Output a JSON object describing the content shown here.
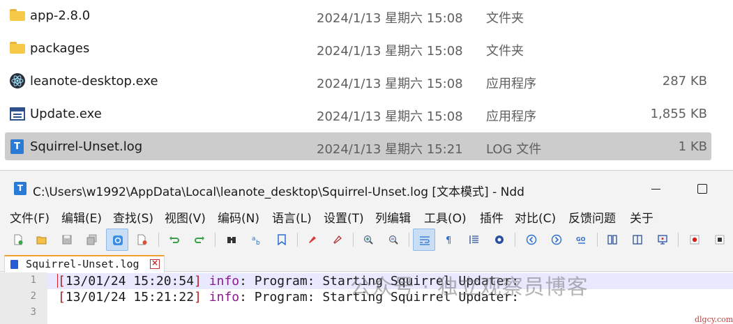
{
  "explorer": {
    "files": [
      {
        "name": "app-2.8.0",
        "date": "2024/1/13 星期六 15:08",
        "type": "文件夹",
        "size": "",
        "icon": "folder-icon",
        "selected": false
      },
      {
        "name": "packages",
        "date": "2024/1/13 星期六 15:08",
        "type": "文件夹",
        "size": "",
        "icon": "folder-icon",
        "selected": false
      },
      {
        "name": "leanote-desktop.exe",
        "date": "2024/1/13 星期六 15:08",
        "type": "应用程序",
        "size": "287 KB",
        "icon": "electron-app-icon",
        "selected": false
      },
      {
        "name": "Update.exe",
        "date": "2024/1/13 星期六 15:08",
        "type": "应用程序",
        "size": "1,855 KB",
        "icon": "exe-window-icon",
        "selected": false
      },
      {
        "name": "Squirrel-Unset.log",
        "date": "2024/1/13 星期六 15:21",
        "type": "LOG 文件",
        "size": "1 KB",
        "icon": "log-file-icon",
        "selected": true
      }
    ],
    "colors": {
      "selected_row": "#cccccc",
      "folder": "#f7c948"
    }
  },
  "window": {
    "title": "C:\\Users\\w1992\\AppData\\Local\\leanote_desktop\\Squirrel-Unset.log [文本模式] - Ndd",
    "menu": [
      "文件(F)",
      "编辑(E)",
      "查找(S)",
      "视图(V)",
      "编码(N)",
      "语言(L)",
      "设置(T)",
      "列编辑",
      "工具(O)",
      "插件",
      "对比(C)",
      "反馈问题",
      "关于"
    ],
    "toolbar_icons": [
      "new-file-icon",
      "open-file-icon",
      "save-icon",
      "save-all-icon",
      "auto-save-icon",
      "close-file-icon",
      "undo-icon",
      "redo-icon",
      "find-icon",
      "replace-icon",
      "bookmark-icon",
      "highlight-icon",
      "clear-highlight-icon",
      "zoom-in-icon",
      "zoom-out-icon",
      "word-wrap-icon",
      "show-symbols-icon",
      "indent-guide-icon",
      "macro-icon",
      "prev-icon",
      "next-icon",
      "goto-icon",
      "compare-icon",
      "split-view-icon",
      "monitor-icon",
      "record-icon",
      "stop-icon"
    ],
    "tab": {
      "label": "Squirrel-Unset.log"
    },
    "editor": {
      "lines": [
        {
          "num": "1",
          "ts": "13/01/24 15:20:54",
          "level": "info",
          "message": ": Program: Starting Squirrel Updater:"
        },
        {
          "num": "2",
          "ts": "13/01/24 15:21:22",
          "level": "info",
          "message": ": Program: Starting Squirrel Updater:"
        },
        {
          "num": "3",
          "ts": "",
          "level": "",
          "message": ""
        }
      ]
    },
    "colors": {
      "accent_tab": "#f0a030",
      "current_line": "#e8e8ff",
      "info": "#8a1a8a",
      "bracket": "#b02020"
    }
  },
  "watermark": {
    "text": "公众号 · 独立观察员博客",
    "site": "dlgcy.com"
  }
}
